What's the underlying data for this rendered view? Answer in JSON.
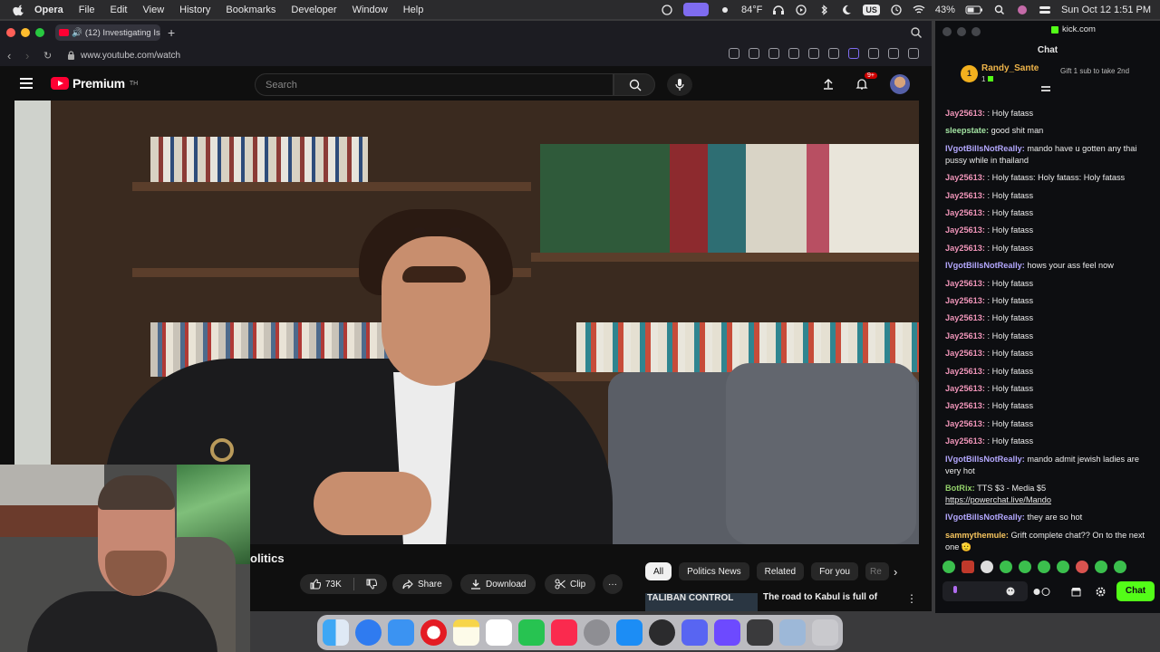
{
  "menubar": {
    "app": "Opera",
    "items": [
      "File",
      "Edit",
      "View",
      "History",
      "Bookmarks",
      "Developer",
      "Window",
      "Help"
    ],
    "weather": "84°F",
    "keyboard": "US",
    "battery": "43%",
    "datetime": "Sun Oct 12  1:51 PM"
  },
  "browser": {
    "tab_title": "(12) Investigating Isr",
    "url": "www.youtube.com/watch"
  },
  "youtube": {
    "logo_text": "Premium",
    "logo_sup": "TH",
    "search_placeholder": "Search",
    "notifications_badge": "9+",
    "video_title_visible": "olitics",
    "like_count": "73K",
    "share_label": "Share",
    "download_label": "Download",
    "clip_label": "Clip",
    "more_label": "···",
    "chips": [
      "All",
      "Politics News",
      "Related",
      "For you",
      "Re"
    ],
    "recommended": {
      "thumb_text": "TALIBAN CONTROL",
      "title": "The road to Kabul is full of"
    }
  },
  "chat_window": {
    "site": "kick.com",
    "header": "Chat",
    "pinned": {
      "user": "Randy_Sante",
      "rank": "1",
      "sub_count": "1",
      "gift_text": "Gift 1 sub to take 2nd"
    },
    "messages": [
      {
        "user": "Jay25613:",
        "text": ": Holy fatass",
        "cls": "u-jay"
      },
      {
        "user": "sleepstate:",
        "text": "good shit man",
        "cls": "u-sleep"
      },
      {
        "user": "IVgotBillsNotReally:",
        "text": "mando have u gotten any thai pussy while in thailand",
        "cls": "u-bills"
      },
      {
        "user": "Jay25613:",
        "text": ": Holy fatass: Holy fatass: Holy fatass",
        "cls": "u-jay"
      },
      {
        "user": "Jay25613:",
        "text": ": Holy fatass",
        "cls": "u-jay"
      },
      {
        "user": "Jay25613:",
        "text": ": Holy fatass",
        "cls": "u-jay"
      },
      {
        "user": "Jay25613:",
        "text": ": Holy fatass",
        "cls": "u-jay"
      },
      {
        "user": "Jay25613:",
        "text": ": Holy fatass",
        "cls": "u-jay"
      },
      {
        "user": "IVgotBillsNotReally:",
        "text": "hows your ass feel now",
        "cls": "u-bills"
      },
      {
        "user": "Jay25613:",
        "text": ": Holy fatass",
        "cls": "u-jay"
      },
      {
        "user": "Jay25613:",
        "text": ": Holy fatass",
        "cls": "u-jay"
      },
      {
        "user": "Jay25613:",
        "text": ": Holy fatass",
        "cls": "u-jay"
      },
      {
        "user": "Jay25613:",
        "text": ": Holy fatass",
        "cls": "u-jay"
      },
      {
        "user": "Jay25613:",
        "text": ": Holy fatass",
        "cls": "u-jay"
      },
      {
        "user": "Jay25613:",
        "text": ": Holy fatass",
        "cls": "u-jay"
      },
      {
        "user": "Jay25613:",
        "text": ": Holy fatass",
        "cls": "u-jay"
      },
      {
        "user": "Jay25613:",
        "text": ": Holy fatass",
        "cls": "u-jay"
      },
      {
        "user": "Jay25613:",
        "text": ": Holy fatass",
        "cls": "u-jay"
      },
      {
        "user": "Jay25613:",
        "text": ": Holy fatass",
        "cls": "u-jay"
      },
      {
        "user": "IVgotBillsNotReally:",
        "text": "mando admit jewish ladies are very hot",
        "cls": "u-bills"
      },
      {
        "user": "BotRix:",
        "text": "TTS $3 - Media $5",
        "link": "https://powerchat.live/Mando",
        "cls": "u-bot"
      },
      {
        "user": "IVgotBillsNotReally:",
        "text": "they are so hot",
        "cls": "u-bills"
      },
      {
        "user": "sammythemule:",
        "text": "Grift complete chat?? On to the next one 🫡",
        "cls": "u-sammy"
      }
    ],
    "send_label": "Chat"
  },
  "colors": {
    "youtube_red": "#ff0033",
    "kick_green": "#53fc18",
    "dock_bg": "#d2d2d7"
  }
}
